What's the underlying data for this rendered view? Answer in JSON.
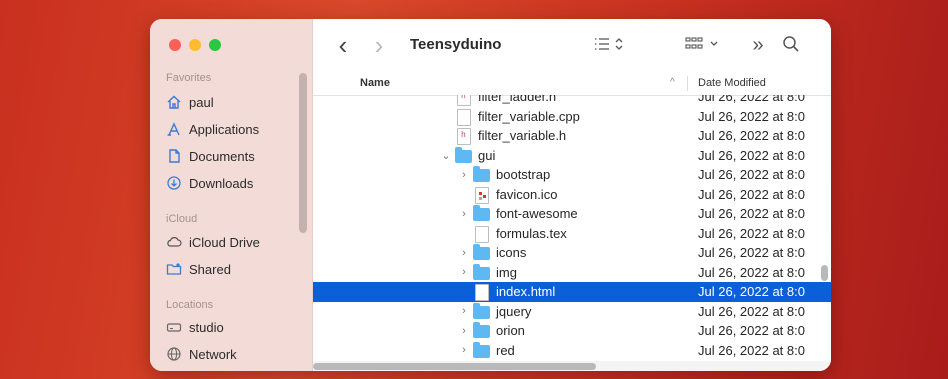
{
  "window": {
    "title": "Teensyduino"
  },
  "colors": {
    "selection": "#0b5fd8",
    "folder": "#5eb8f1",
    "close": "#fe5f57",
    "minimize": "#febc2e",
    "zoom": "#28c840"
  },
  "sidebar": {
    "favorites_label": "Favorites",
    "favorites": [
      {
        "label": "paul",
        "icon": "home-icon"
      },
      {
        "label": "Applications",
        "icon": "applications-icon"
      },
      {
        "label": "Documents",
        "icon": "document-icon"
      },
      {
        "label": "Downloads",
        "icon": "download-icon"
      }
    ],
    "icloud_label": "iCloud",
    "icloud": [
      {
        "label": "iCloud Drive",
        "icon": "cloud-icon"
      },
      {
        "label": "Shared",
        "icon": "shared-folder-icon"
      }
    ],
    "locations_label": "Locations",
    "locations": [
      {
        "label": "studio",
        "icon": "drive-icon"
      },
      {
        "label": "Network",
        "icon": "network-icon"
      }
    ]
  },
  "toolbar": {
    "back": "‹",
    "forward": "›",
    "view_icon": "list-view-icon",
    "group_icon": "grid-icon",
    "more": "»",
    "search_icon": "search-icon"
  },
  "columns": {
    "name": "Name",
    "date": "Date Modified",
    "sort_indicator": "^"
  },
  "rows": [
    {
      "name": "filter_ladder.h",
      "date": "Jul 26, 2022 at 8:0",
      "type": "h"
    },
    {
      "name": "filter_variable.cpp",
      "date": "Jul 26, 2022 at 8:0",
      "type": "file"
    },
    {
      "name": "filter_variable.h",
      "date": "Jul 26, 2022 at 8:0",
      "type": "h"
    },
    {
      "name": "gui",
      "date": "Jul 26, 2022 at 8:0",
      "type": "folder",
      "expanded": true
    },
    {
      "name": "bootstrap",
      "date": "Jul 26, 2022 at 8:0",
      "type": "folder"
    },
    {
      "name": "favicon.ico",
      "date": "Jul 26, 2022 at 8:0",
      "type": "ico"
    },
    {
      "name": "font-awesome",
      "date": "Jul 26, 2022 at 8:0",
      "type": "folder"
    },
    {
      "name": "formulas.tex",
      "date": "Jul 26, 2022 at 8:0",
      "type": "file"
    },
    {
      "name": "icons",
      "date": "Jul 26, 2022 at 8:0",
      "type": "folder"
    },
    {
      "name": "img",
      "date": "Jul 26, 2022 at 8:0",
      "type": "folder"
    },
    {
      "name": "index.html",
      "date": "Jul 26, 2022 at 8:0",
      "type": "file",
      "selected": true
    },
    {
      "name": "jquery",
      "date": "Jul 26, 2022 at 8:0",
      "type": "folder"
    },
    {
      "name": "orion",
      "date": "Jul 26, 2022 at 8:0",
      "type": "folder"
    },
    {
      "name": "red",
      "date": "Jul 26, 2022 at 8:0",
      "type": "folder"
    }
  ]
}
